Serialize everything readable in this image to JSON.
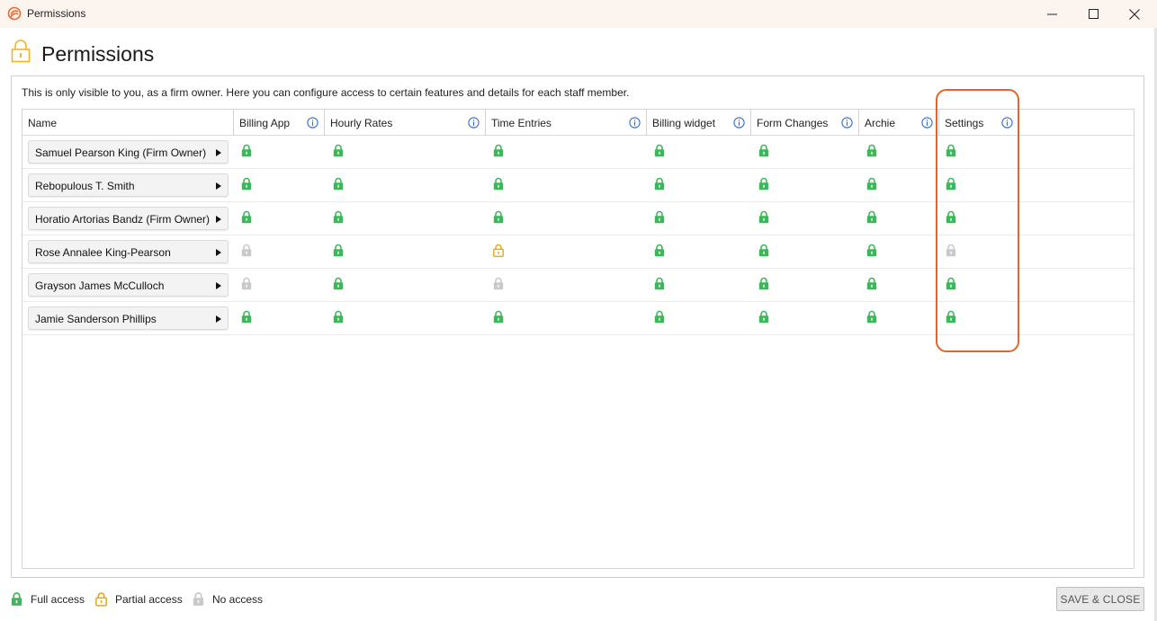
{
  "window": {
    "title": "Permissions"
  },
  "header": {
    "title": "Permissions"
  },
  "description": "This is only visible to you, as a firm owner. Here you can configure access to certain features and details for each staff member.",
  "columns": [
    {
      "label": "Name"
    },
    {
      "label": "Billing App"
    },
    {
      "label": "Hourly Rates"
    },
    {
      "label": "Time Entries"
    },
    {
      "label": "Billing widget"
    },
    {
      "label": "Form Changes"
    },
    {
      "label": "Archie"
    },
    {
      "label": "Settings"
    }
  ],
  "rows": [
    {
      "name": "Samuel Pearson King (Firm Owner)",
      "access": [
        "full",
        "full",
        "full",
        "full",
        "full",
        "full",
        "full"
      ]
    },
    {
      "name": "Rebopulous T. Smith",
      "access": [
        "full",
        "full",
        "full",
        "full",
        "full",
        "full",
        "full"
      ]
    },
    {
      "name": "Horatio Artorias Bandz (Firm Owner)",
      "access": [
        "full",
        "full",
        "full",
        "full",
        "full",
        "full",
        "full"
      ]
    },
    {
      "name": "Rose Annalee King-Pearson",
      "access": [
        "none",
        "full",
        "partial",
        "full",
        "full",
        "full",
        "none"
      ]
    },
    {
      "name": "Grayson James McCulloch",
      "access": [
        "none",
        "full",
        "none",
        "full",
        "full",
        "full",
        "full"
      ]
    },
    {
      "name": "Jamie Sanderson Phillips",
      "access": [
        "full",
        "full",
        "full",
        "full",
        "full",
        "full",
        "full"
      ]
    }
  ],
  "legend": {
    "full": "Full access",
    "partial": "Partial access",
    "none": "No access"
  },
  "colors": {
    "full": "#3cb85a",
    "partial": "#e8a817",
    "none": "#c9c9c9",
    "highlight": "#e0662a"
  },
  "footer": {
    "save_close": "SAVE & CLOSE"
  }
}
